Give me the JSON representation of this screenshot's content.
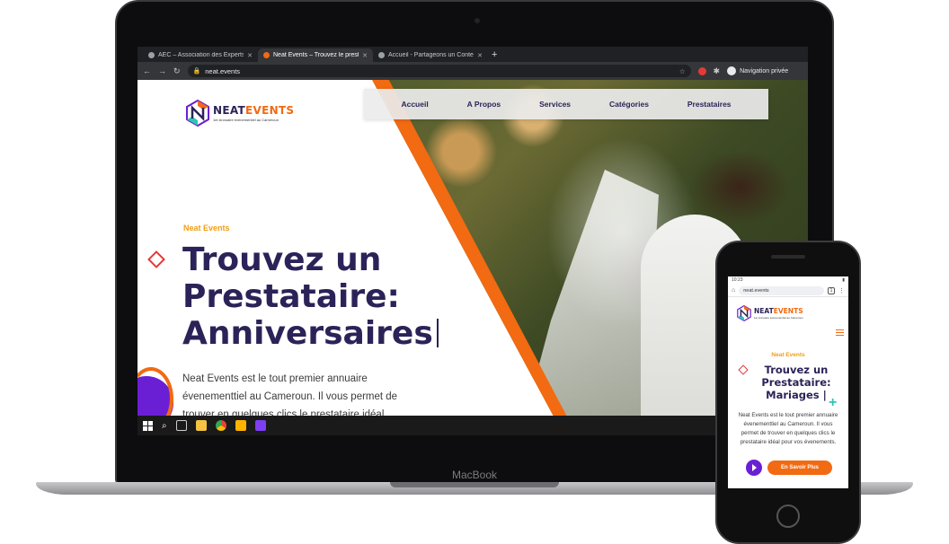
{
  "laptop": {
    "brand_label": "MacBook",
    "browser": {
      "tabs": [
        {
          "title": "AEC – Association des Experts en",
          "active": false
        },
        {
          "title": "Neat Events – Trouvez le prestataire",
          "active": true
        },
        {
          "title": "Accueil - Partageons un Contenu",
          "active": false
        }
      ],
      "new_tab_symbol": "+",
      "address": "neat.events",
      "private_label": "Navigation privée"
    },
    "site": {
      "logo": {
        "part1": "NEAT",
        "part2": "EVENTS",
        "tagline": "1er Annuaire évenementiel au Cameroun"
      },
      "nav": [
        "Accueil",
        "A Propos",
        "Services",
        "Catégories",
        "Prestataires"
      ],
      "eyebrow": "Neat Events",
      "headline_line1": "Trouvez un",
      "headline_line2": "Prestataire:",
      "headline_line3": "Anniversaires",
      "paragraph": "Neat Events est le tout premier annuaire évenementtiel au Cameroun. Il vous permet de trouver en quelques clics le prestataire idéal"
    },
    "taskbar_icons": [
      "windows-start-icon",
      "search-icon",
      "task-view-icon",
      "file-explorer-icon",
      "chrome-icon",
      "app-icon",
      "app-icon-2"
    ]
  },
  "phone": {
    "status_time": "10:23",
    "address": "neat.events",
    "tab_count": "1",
    "logo": {
      "part1": "NEAT",
      "part2": "EVENTS",
      "tagline": "1er Annuaire évenementiel au Cameroun"
    },
    "eyebrow": "Neat Events",
    "headline_line1": "Trouvez un",
    "headline_line2": "Prestataire:",
    "headline_line3": "Mariages",
    "paragraph": "Neat Events est le tout premier annuaire évenementtiel au Cameroun. Il vous permet de trouver en quelques clics le prestataire idéal pour vos évenements.",
    "cta_label": "En Savoir Plus"
  },
  "colors": {
    "brand_navy": "#2b2358",
    "brand_orange": "#f26a12",
    "accent_purple": "#6b1fd4",
    "accent_red": "#e53935",
    "accent_teal": "#2ec4b6"
  }
}
